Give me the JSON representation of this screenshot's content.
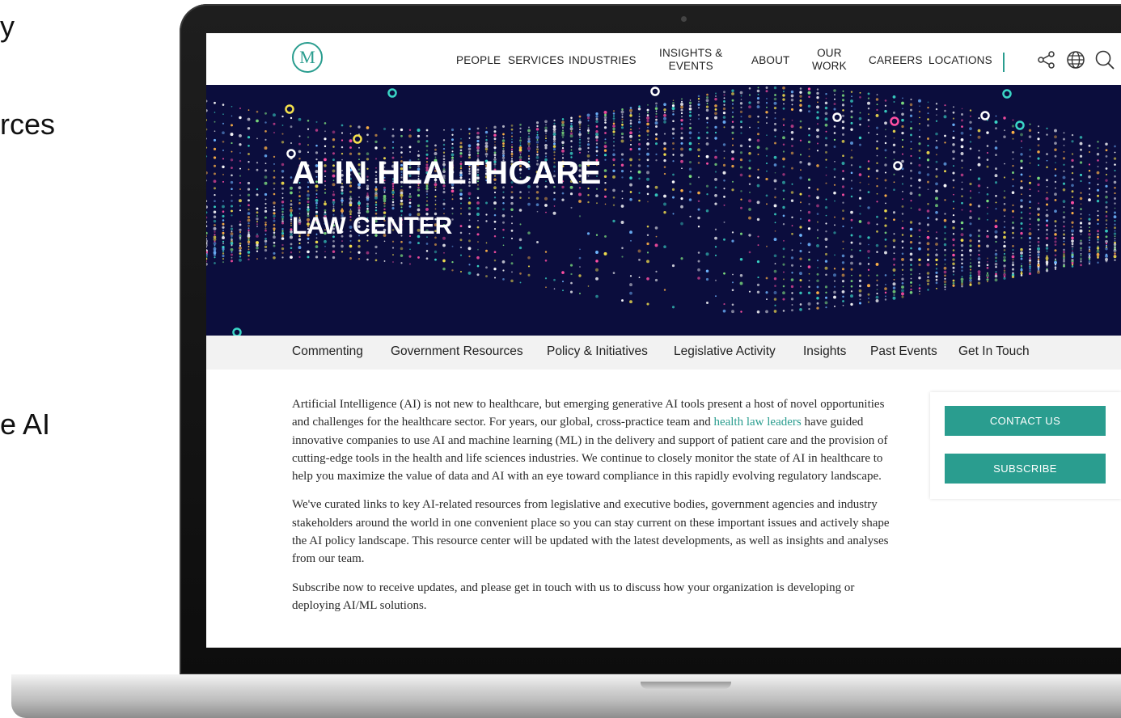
{
  "side_fragments": [
    "y",
    "rces",
    "e AI"
  ],
  "logo": "M",
  "nav": [
    {
      "label": "PEOPLE"
    },
    {
      "label": "SERVICES"
    },
    {
      "label": "INDUSTRIES"
    },
    {
      "label": "INSIGHTS &\nEVENTS"
    },
    {
      "label": "ABOUT"
    },
    {
      "label": "OUR\nWORK"
    },
    {
      "label": "CAREERS"
    },
    {
      "label": "LOCATIONS"
    }
  ],
  "header_icons": [
    "share-icon",
    "globe-icon",
    "search-icon"
  ],
  "hero": {
    "title": "AI IN HEALTHCARE",
    "subtitle": "LAW CENTER"
  },
  "subnav": [
    "Commenting",
    "Government Resources",
    "Policy & Initiatives",
    "Legislative Activity",
    "Insights",
    "Past Events",
    "Get In Touch"
  ],
  "content": {
    "p1_before_link": "Artificial Intelligence (AI) is not new to healthcare, but emerging generative AI tools present a host of novel opportunities and challenges for the healthcare sector. For years, our global, cross-practice team and ",
    "p1_link": "health law leaders",
    "p1_after_link": " have guided innovative companies to use AI and machine learning (ML) in the delivery and support of patient care and the provision of cutting-edge tools in the health and life sciences industries. We continue to closely monitor the state of AI in healthcare to help you maximize the value of data and AI with an eye toward compliance in this rapidly evolving regulatory landscape.",
    "p2": "We've curated links to key AI-related resources from legislative and executive bodies, government agencies and industry stakeholders around the world in one convenient place so you can stay current on these important issues and actively shape the AI policy landscape. This resource center will be updated with the latest developments, as well as insights and analyses from our team.",
    "p3": "Subscribe now to receive updates, and please get in touch with us to discuss how your organization is developing or deploying AI/ML solutions."
  },
  "cta": {
    "contact_label": "CONTACT US",
    "subscribe_label": "SUBSCRIBE"
  },
  "colors": {
    "brand_teal": "#2a9d8f",
    "hero_bg": "#0b0d3d",
    "subnav_bg": "#f2f2f2"
  }
}
